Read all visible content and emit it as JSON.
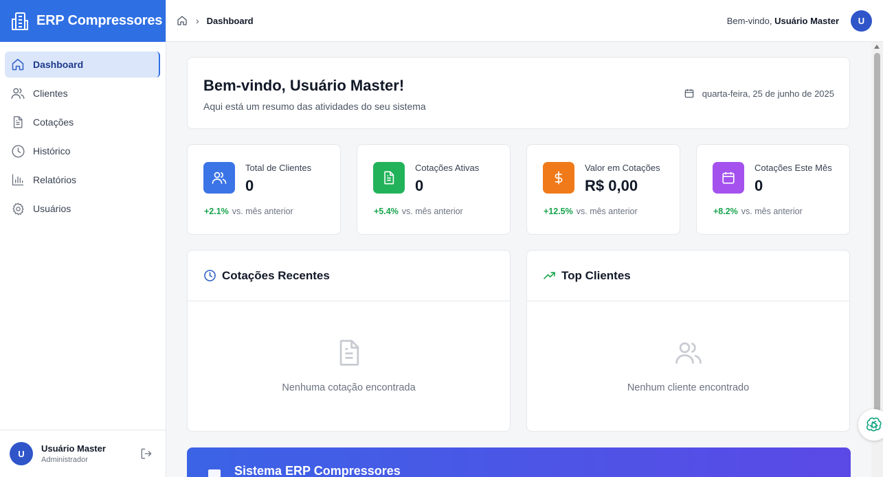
{
  "app": {
    "brand": "ERP Compressores",
    "brand_color": "#2f6fe4"
  },
  "sidebar": {
    "items": [
      {
        "label": "Dashboard",
        "icon": "home-icon",
        "active": true
      },
      {
        "label": "Clientes",
        "icon": "users-icon"
      },
      {
        "label": "Cotações",
        "icon": "document-icon"
      },
      {
        "label": "Histórico",
        "icon": "clock-icon"
      },
      {
        "label": "Relatórios",
        "icon": "bar-chart-icon"
      },
      {
        "label": "Usuários",
        "icon": "gear-icon"
      }
    ],
    "user": {
      "initial": "U",
      "name": "Usuário Master",
      "role": "Administrador"
    }
  },
  "header": {
    "breadcrumb_current": "Dashboard",
    "welcome_prefix": "Bem-vindo,",
    "welcome_name": "Usuário Master",
    "avatar_initial": "U"
  },
  "hero": {
    "title": "Bem-vindo, Usuário Master!",
    "subtitle": "Aqui está um resumo das atividades do seu sistema",
    "date": "quarta-feira, 25 de junho de 2025"
  },
  "stats": [
    {
      "label": "Total de Clientes",
      "value": "0",
      "change": "+2.1%",
      "suffix": "vs. mês anterior",
      "icon": "users-icon",
      "color": "#3b74e6"
    },
    {
      "label": "Cotações Ativas",
      "value": "0",
      "change": "+5.4%",
      "suffix": "vs. mês anterior",
      "icon": "document-icon",
      "color": "#22b35a"
    },
    {
      "label": "Valor em Cotações",
      "value": "R$ 0,00",
      "change": "+12.5%",
      "suffix": "vs. mês anterior",
      "icon": "dollar-icon",
      "color": "#f07a1a"
    },
    {
      "label": "Cotações Este Mês",
      "value": "0",
      "change": "+8.2%",
      "suffix": "vs. mês anterior",
      "icon": "calendar-icon",
      "color": "#a451ee"
    }
  ],
  "panels": {
    "recent": {
      "title": "Cotações Recentes",
      "empty": "Nenhuma cotação encontrada"
    },
    "top": {
      "title": "Top Clientes",
      "empty": "Nenhum cliente encontrado"
    }
  },
  "banner": {
    "title": "Sistema ERP Compressores"
  }
}
